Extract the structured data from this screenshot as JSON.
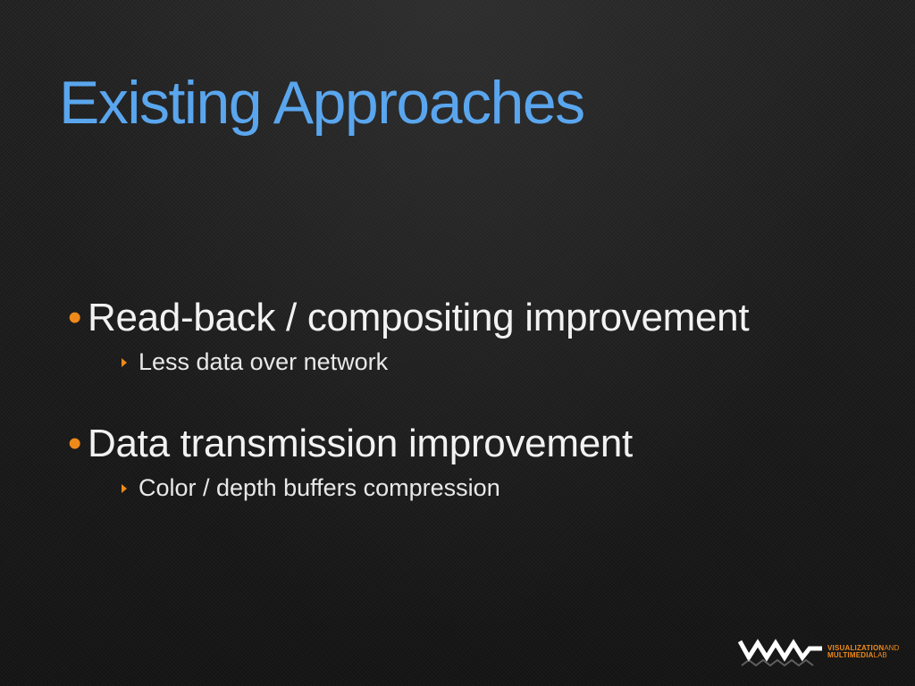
{
  "slide": {
    "title": "Existing Approaches",
    "bullets": [
      {
        "text": "Read-back / compositing improvement",
        "sub": [
          "Less data over network"
        ]
      },
      {
        "text": "Data transmission improvement",
        "sub": [
          "Color / depth buffers compression"
        ]
      }
    ]
  },
  "logo": {
    "line1_strong": "VISUALIZATION",
    "line1_light": "AND",
    "line2_strong": "MULTIMEDIA",
    "line2_light": "LAB"
  },
  "colors": {
    "title": "#5aa6ee",
    "bullet_marker": "#ef8a1a",
    "text": "#f2f2f2",
    "background": "#1a1a1a"
  },
  "icons": {
    "bullet": "bullet-dot-icon",
    "sub_bullet": "triangle-right-icon",
    "logo": "vmlab-logo-icon"
  }
}
